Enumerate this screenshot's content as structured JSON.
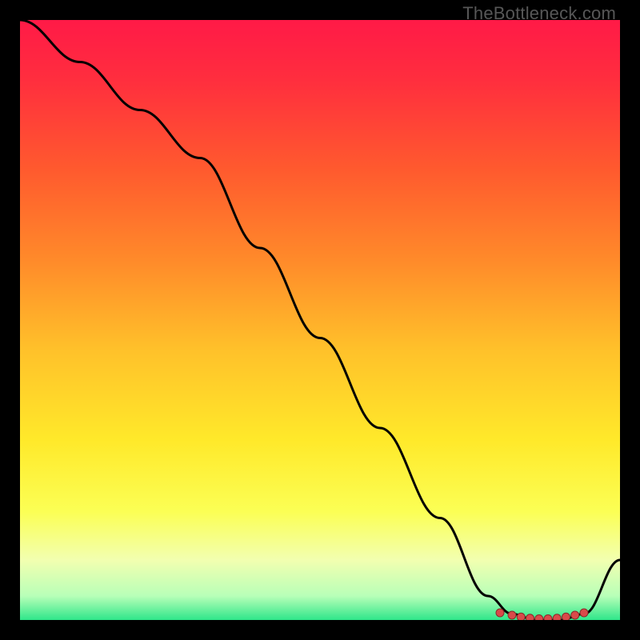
{
  "watermark": "TheBottleneck.com",
  "chart_data": {
    "type": "line",
    "title": "",
    "xlabel": "",
    "ylabel": "",
    "xlim": [
      0,
      100
    ],
    "ylim": [
      0,
      100
    ],
    "series": [
      {
        "name": "curve",
        "x": [
          0,
          10,
          20,
          30,
          40,
          50,
          60,
          70,
          78,
          82,
          86,
          90,
          94,
          100
        ],
        "y": [
          100,
          93,
          85,
          77,
          62,
          47,
          32,
          17,
          4,
          1,
          0,
          0,
          1,
          10
        ]
      }
    ],
    "markers": {
      "name": "bottom-cluster",
      "x": [
        80,
        82,
        83.5,
        85,
        86.5,
        88,
        89.5,
        91,
        92.5,
        94
      ],
      "y": [
        1.2,
        0.8,
        0.5,
        0.3,
        0.2,
        0.2,
        0.3,
        0.5,
        0.8,
        1.2
      ],
      "color": "#d94a4a"
    },
    "gradient_stops": [
      {
        "offset": 0.0,
        "color": "#ff1a47"
      },
      {
        "offset": 0.1,
        "color": "#ff2e3e"
      },
      {
        "offset": 0.25,
        "color": "#ff5a2e"
      },
      {
        "offset": 0.4,
        "color": "#ff8a2a"
      },
      {
        "offset": 0.55,
        "color": "#ffc12a"
      },
      {
        "offset": 0.7,
        "color": "#ffe92a"
      },
      {
        "offset": 0.82,
        "color": "#fbff55"
      },
      {
        "offset": 0.9,
        "color": "#f2ffb0"
      },
      {
        "offset": 0.96,
        "color": "#b8ffb8"
      },
      {
        "offset": 1.0,
        "color": "#2fe68a"
      }
    ]
  }
}
